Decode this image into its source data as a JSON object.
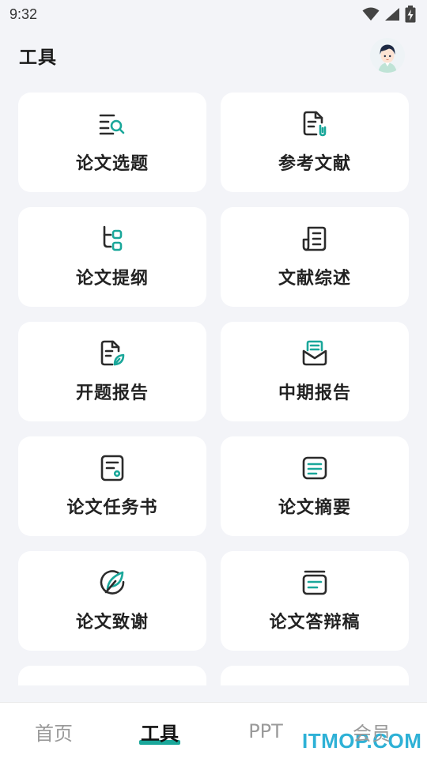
{
  "status_bar": {
    "time": "9:32",
    "icons": [
      "wifi-icon",
      "signal-icon",
      "battery-charging-icon"
    ]
  },
  "header": {
    "title": "工具",
    "avatar": "user-avatar"
  },
  "tools": [
    {
      "label": "论文选题",
      "icon": "list-search-icon"
    },
    {
      "label": "参考文献",
      "icon": "document-link-icon"
    },
    {
      "label": "论文提纲",
      "icon": "outline-tree-icon"
    },
    {
      "label": "文献综述",
      "icon": "newspaper-icon"
    },
    {
      "label": "开题报告",
      "icon": "document-leaf-icon"
    },
    {
      "label": "中期报告",
      "icon": "mail-report-icon"
    },
    {
      "label": "论文任务书",
      "icon": "task-sheet-icon"
    },
    {
      "label": "论文摘要",
      "icon": "abstract-icon"
    },
    {
      "label": "论文致谢",
      "icon": "feather-circle-icon"
    },
    {
      "label": "论文答辩稿",
      "icon": "defense-script-icon"
    },
    {
      "label": "",
      "icon": ""
    },
    {
      "label": "",
      "icon": ""
    }
  ],
  "bottom_nav": {
    "items": [
      {
        "label": "首页",
        "active": false
      },
      {
        "label": "工具",
        "active": true
      },
      {
        "label": "PPT",
        "active": false
      },
      {
        "label": "会员",
        "active": false
      }
    ]
  },
  "watermark": "ITMOP.COM",
  "colors": {
    "accent": "#1aa79a",
    "background": "#f3f4f8",
    "card": "#ffffff",
    "icon_dark": "#2b2b2b"
  }
}
